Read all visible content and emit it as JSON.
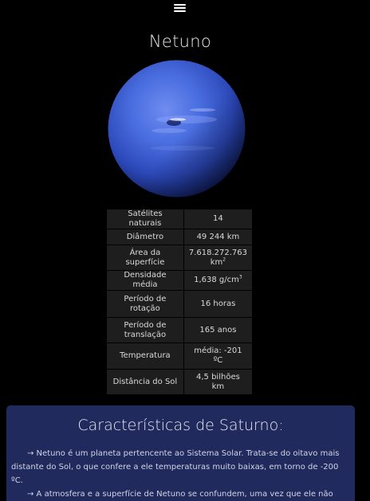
{
  "nav": {
    "menu_icon": "hamburger-menu-icon"
  },
  "page": {
    "title": "Netuno"
  },
  "planet_image": {
    "alt": "Netuno"
  },
  "table": {
    "rows": [
      {
        "label": "Satélites naturais",
        "value": "14"
      },
      {
        "label": "Diâmetro",
        "value": "49 244 km"
      },
      {
        "label": "Área da superfície",
        "value": "7.618.272.763 km",
        "value_sup": "2"
      },
      {
        "label": "Densidade média",
        "value": "1,638 g/cm",
        "value_sup": "3"
      },
      {
        "label": "Período de rotação",
        "value": "16 horas"
      },
      {
        "label": "Período de translação",
        "value": "165 anos"
      },
      {
        "label": "Temperatura",
        "value": "média: -201 ºC"
      },
      {
        "label": "Distância do Sol",
        "value": "4,5 bilhões km"
      }
    ]
  },
  "card": {
    "title": "Características de Saturno:",
    "paragraphs": [
      "→ Netuno é um planeta pertencente ao Sistema Solar. Trata-se do oitavo mais distante do Sol, o que confere a ele temperaturas muito baixas, em torno de -200 ºC.",
      "→ A atmosfera e a superfície de Netuno se confundem, uma vez que ele não apresenta uma camada superficial sólida."
    ]
  },
  "colors": {
    "background": "#000000",
    "table_cell": "#1e1e1e",
    "card_background": "#212a5c",
    "planet_blue": "#3a5fd0"
  }
}
